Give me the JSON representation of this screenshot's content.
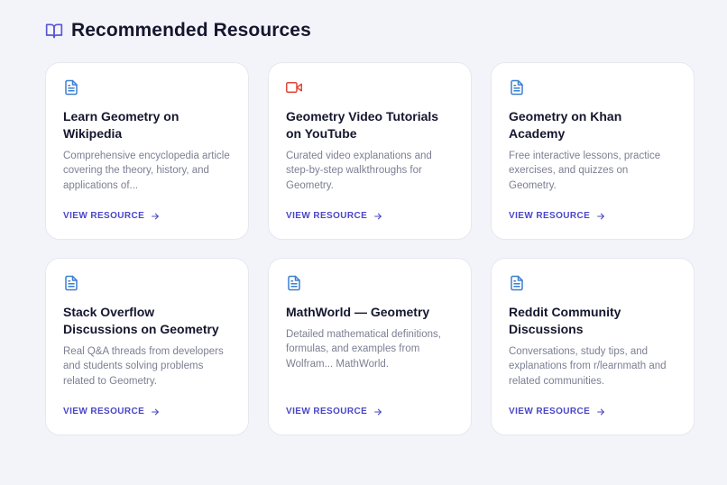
{
  "section": {
    "title": "Recommended Resources",
    "icon": "book-open-icon"
  },
  "colors": {
    "accent": "#4b46c8",
    "document_icon": "#3b7fd1",
    "video_icon": "#e0483a",
    "header_icon": "#5a54d6",
    "background": "#f3f4f9"
  },
  "cards": [
    {
      "icon": "document-icon",
      "title": "Learn Geometry on Wikipedia",
      "description": "Comprehensive encyclopedia article covering the theory, history, and applications of...",
      "link_label": "VIEW RESOURCE"
    },
    {
      "icon": "video-icon",
      "title": "Geometry Video Tutorials on YouTube",
      "description": "Curated video explanations and step-by-step walkthroughs for Geometry.",
      "link_label": "VIEW RESOURCE"
    },
    {
      "icon": "document-icon",
      "title": "Geometry on Khan Academy",
      "description": "Free interactive lessons, practice exercises, and quizzes on Geometry.",
      "link_label": "VIEW RESOURCE"
    },
    {
      "icon": "document-icon",
      "title": "Stack Overflow Discussions on Geometry",
      "description": "Real Q&A threads from developers and students solving problems related to Geometry.",
      "link_label": "VIEW RESOURCE"
    },
    {
      "icon": "document-icon",
      "title": "MathWorld — Geometry",
      "description": "Detailed mathematical definitions, formulas, and examples from Wolfram... MathWorld.",
      "link_label": "VIEW RESOURCE"
    },
    {
      "icon": "document-icon",
      "title": "Reddit Community Discussions",
      "description": "Conversations, study tips, and explanations from r/learnmath and related communities.",
      "link_label": "VIEW RESOURCE"
    }
  ]
}
